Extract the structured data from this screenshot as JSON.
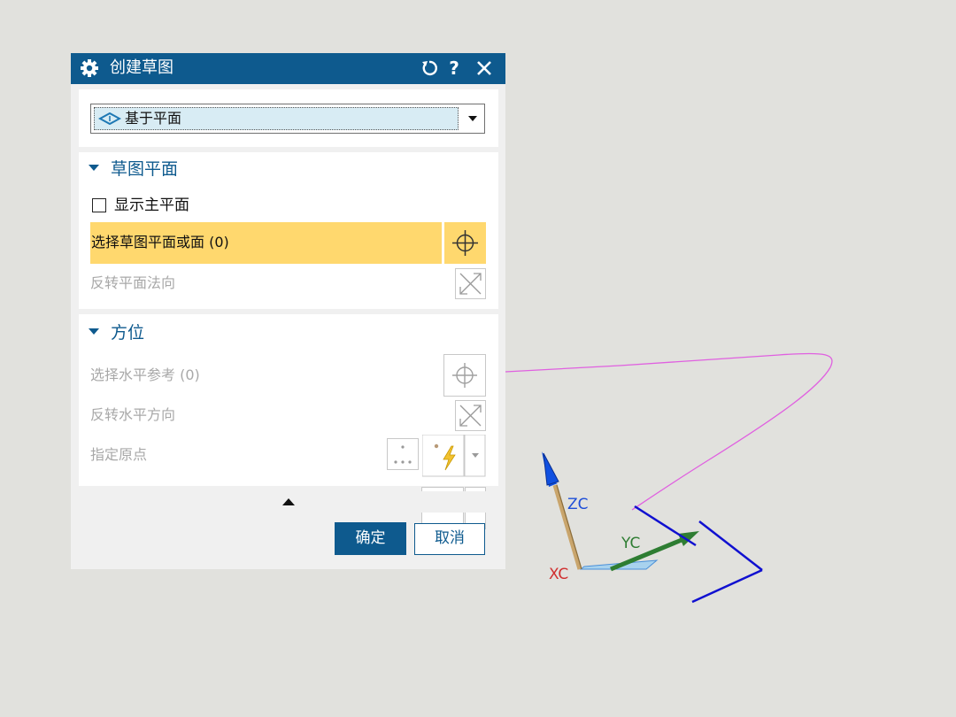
{
  "viewport": {
    "axis_labels": {
      "z": "ZC",
      "y": "YC",
      "x": "XC"
    },
    "colors": {
      "background": "#e1e1dd",
      "curve": "#e060e0",
      "z_axis": "#1050e0",
      "y_axis": "#2e7d32",
      "x_axis": "#d03030",
      "sketch_lines": "#1010d0",
      "rod": "#c9a56c"
    }
  },
  "dialog": {
    "title": "创建草图",
    "title_icon": "gear-icon",
    "header_buttons": [
      "reset-icon",
      "help-icon",
      "close-icon"
    ],
    "help_glyph": "?",
    "type_select": {
      "value": "基于平面",
      "icon": "plane-icon"
    },
    "sketch_plane": {
      "title": "草图平面",
      "show_main_plane": {
        "label": "显示主平面",
        "checked": false
      },
      "select_plane": {
        "label": "选择草图平面或面 (0)",
        "icon": "crosshair-icon",
        "highlighted": true
      },
      "reverse_normal": {
        "label": "反转平面法向",
        "icon": "reverse-direction-icon",
        "enabled": false
      }
    },
    "orientation": {
      "title": "方位",
      "select_horizontal_ref": {
        "label": "选择水平参考 (0)",
        "icon": "crosshair-icon",
        "enabled": false
      },
      "reverse_horizontal": {
        "label": "反转水平方向",
        "icon": "reverse-direction-icon",
        "enabled": false
      },
      "specify_origin": {
        "label": "指定原点",
        "icons": [
          "point-dialog-icon",
          "inferred-point-icon",
          "dropdown-arrow-icon"
        ],
        "enabled": false
      }
    },
    "collapse_icon": "collapse-up-icon",
    "buttons": {
      "ok": "确定",
      "cancel": "取消"
    },
    "colors": {
      "title_bar": "#0e5a8e",
      "accent": "#0e5a8e",
      "highlight": "#ffd86e",
      "combo_bg": "#d8ecf4"
    }
  }
}
